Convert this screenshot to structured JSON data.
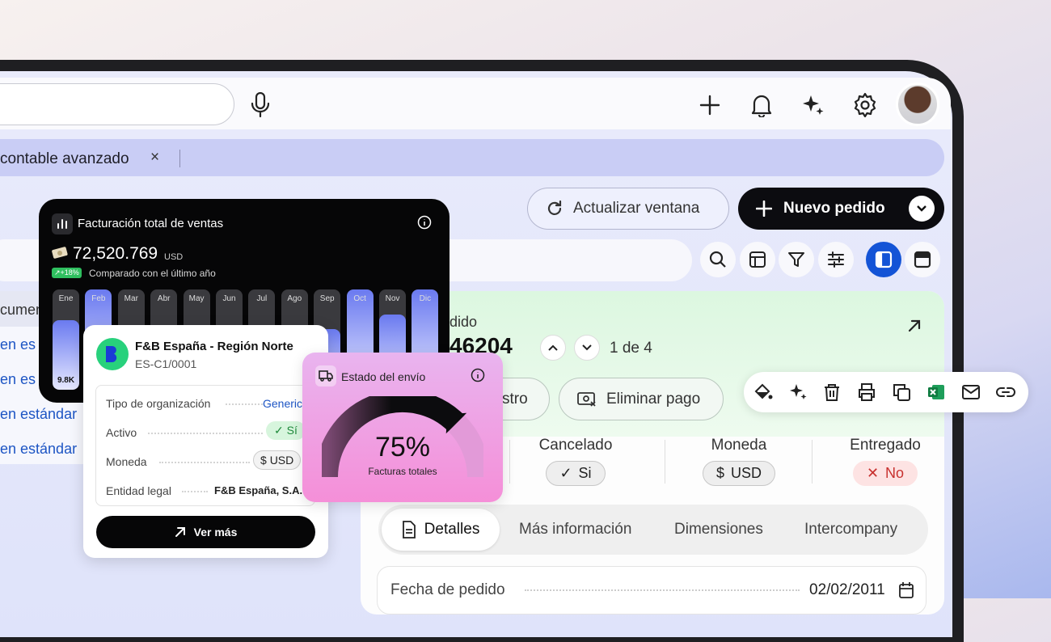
{
  "colors": {
    "accent": "#1454d6",
    "brand_dark": "#060607",
    "success": "#2fbf5f",
    "danger": "#c8312f"
  },
  "tab": {
    "label": "contable avanzado",
    "close": "×"
  },
  "header": {
    "refresh_label": "Actualizar ventana",
    "new_order_label": "Nuevo pedido",
    "icons": [
      "microphone-icon",
      "plus-icon",
      "bell-icon",
      "sparkle-icon",
      "gear-icon"
    ]
  },
  "left_list": {
    "header": "cumen",
    "items": [
      "en es",
      "en es",
      "en estándar",
      "en estándar"
    ]
  },
  "detail": {
    "label": "edido",
    "number": "46204",
    "pager": "1 de 4",
    "actions": {
      "register": "stro",
      "delete_payment": "Eliminar pago"
    },
    "status": [
      {
        "label": "Cancelado",
        "value": "Si",
        "icon": "✓"
      },
      {
        "label": "Moneda",
        "value": "USD",
        "icon": "$"
      },
      {
        "label": "Entregado",
        "value": "No",
        "icon": "✕"
      }
    ],
    "tabs": [
      "Detalles",
      "Más información",
      "Dimensiones",
      "Intercompany"
    ],
    "field": {
      "key": "Fecha de pedido",
      "value": "02/02/2011"
    }
  },
  "sales_card": {
    "title": "Facturación total de ventas",
    "value": "72,520.769",
    "unit": "USD",
    "badge": "↗+18%",
    "comparison": "Comparado con el último año",
    "months": [
      "Ene",
      "Feb",
      "Mar",
      "Abr",
      "May",
      "Jun",
      "Jul",
      "Ago",
      "Sep",
      "Oct",
      "Nov",
      "Dic"
    ],
    "levels": [
      0.66,
      1.0,
      0.0,
      0.0,
      0.34,
      0.0,
      0.0,
      0.25,
      0.56,
      1.0,
      0.72,
      1.0
    ],
    "first_bar_value": "9.8K"
  },
  "entity_card": {
    "name": "F&B España - Región Norte",
    "code": "ES-C1/0001",
    "rows": [
      {
        "k": "Tipo de organización",
        "v": "Generic"
      },
      {
        "k": "Activo",
        "v": "Sí"
      },
      {
        "k": "Moneda",
        "v": "USD"
      },
      {
        "k": "Entidad legal",
        "v": "F&B España, S.A."
      }
    ],
    "button": "Ver más"
  },
  "shipping_card": {
    "title": "Estado del envío",
    "value": "75%",
    "subtitle": "Facturas totales",
    "progress": 0.75
  }
}
